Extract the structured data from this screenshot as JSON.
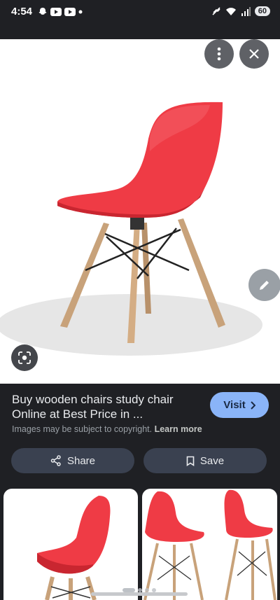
{
  "status_bar": {
    "time": "4:54",
    "battery": "60"
  },
  "result": {
    "title": "Buy wooden chairs study chair Online at Best Price in ...",
    "visit_label": "Visit",
    "copyright_text": "Images may be subject to copyright.",
    "learn_more": "Learn more"
  },
  "actions": {
    "share_label": "Share",
    "save_label": "Save"
  },
  "colors": {
    "background": "#1f2024",
    "visit_button": "#8ab4f8",
    "action_button": "#3a4150",
    "chair_red": "#ef3b45",
    "wood_leg": "#c8a27a"
  },
  "icons": [
    "more-vert-icon",
    "close-icon",
    "lens-icon",
    "edit-icon",
    "share-icon",
    "bookmark-icon",
    "chevron-right-icon"
  ]
}
